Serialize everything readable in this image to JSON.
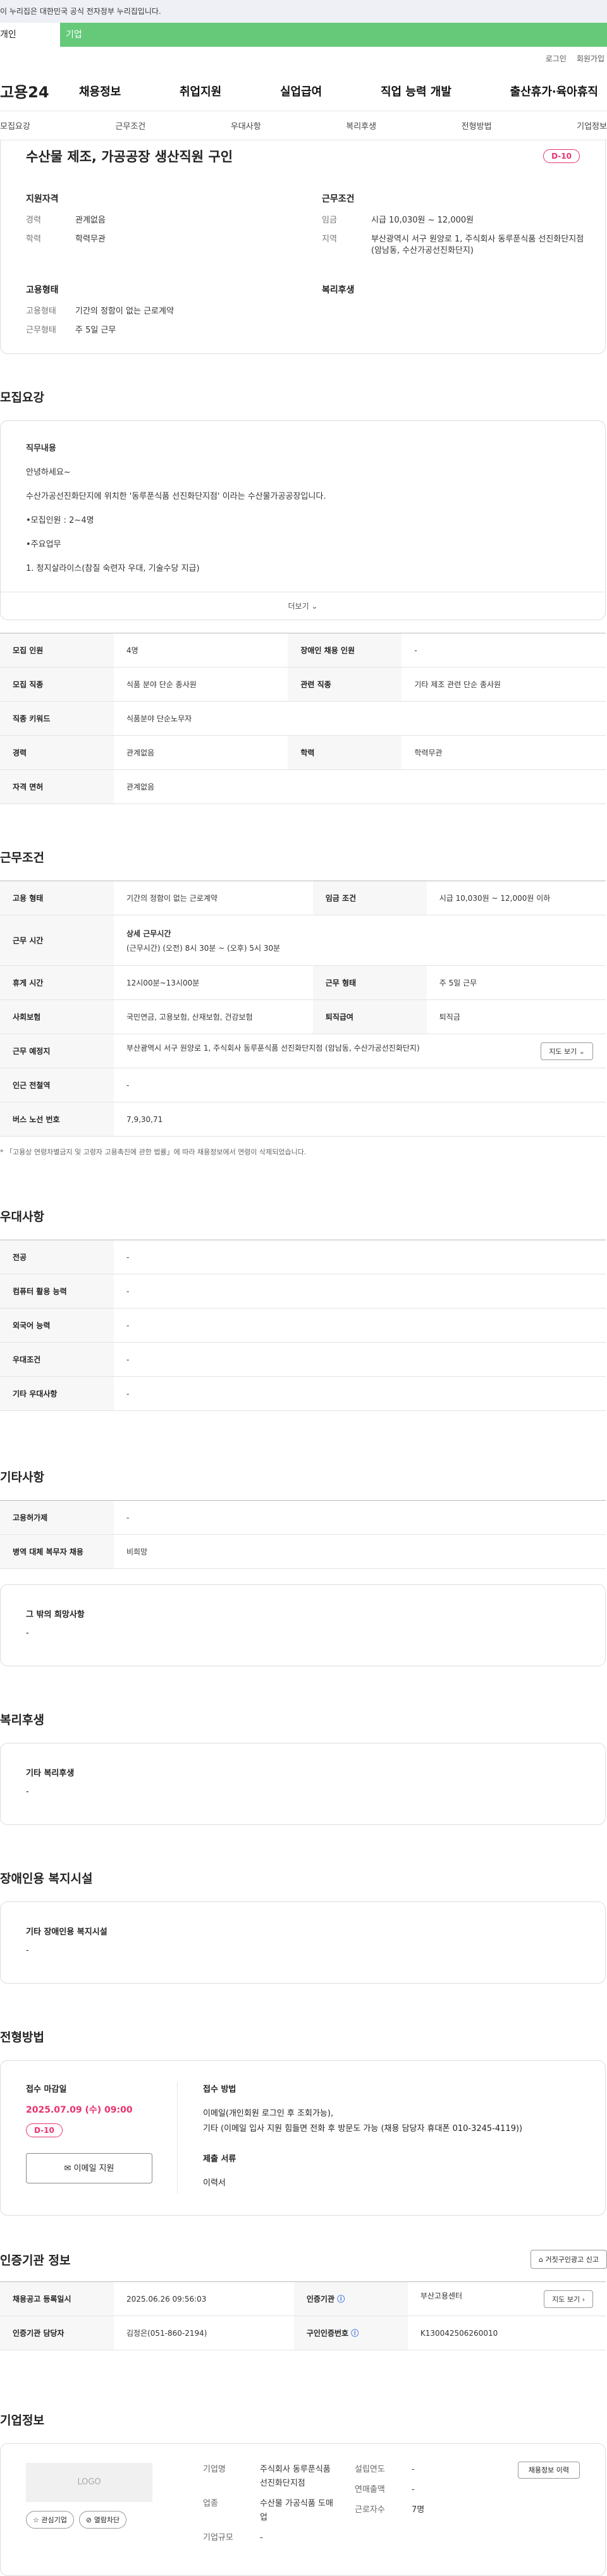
{
  "gov_banner": "이 누리집은 대한민국 공식 전자정부 누리집입니다.",
  "tabs": [
    {
      "label": "개인"
    },
    {
      "label": "기업"
    }
  ],
  "util": {
    "login": "로그인",
    "signup": "회원가입"
  },
  "gnb": {
    "logo": "고용24",
    "menu": [
      "채용정보",
      "취업지원",
      "실업급여",
      "직업 능력 개발",
      "출산휴가·육아휴직"
    ]
  },
  "subnav": [
    "모집요강",
    "근무조건",
    "우대사항",
    "복리후생",
    "전형방법",
    "기업정보"
  ],
  "summary": {
    "title": "수산물 제조, 가공공장 생산직원 구인",
    "dday": "D-10",
    "qual_title": "지원자격",
    "qual": [
      {
        "k": "경력",
        "v": "관계없음"
      },
      {
        "k": "학력",
        "v": "학력무관"
      }
    ],
    "cond_title": "근무조건",
    "cond": [
      {
        "k": "임금",
        "v": "시급 10,030원 ~ 12,000원"
      },
      {
        "k": "지역",
        "v": "부산광역시 서구 원양로 1, 주식회사 동루푼식품 선진화단지점 (암남동, 수산가공선진화단지)"
      }
    ],
    "emp_title": "고용형태",
    "emp": [
      {
        "k": "고용형태",
        "v": "기간의 정함이 없는 근로계약"
      },
      {
        "k": "근무형태",
        "v": "주 5일 근무"
      }
    ],
    "welfare_title": "복리후생"
  },
  "recruit": {
    "section_title": "모집요강",
    "desc_heading": "직무내용",
    "desc_lines": [
      "안녕하세요~",
      "수산가공선진화단지에 위치한 '동루푼식품 선진화단지점' 이라는 수산물가공공장입니다.",
      "•모집인원 : 2~4명",
      "•주요업무",
      "1. 청지살라이스(참질 숙련자 우대, 기술수당 지급)"
    ],
    "more_label": "더보기",
    "rows": [
      {
        "k1": "모집 인원",
        "v1": "4명",
        "k2": "장애인 채용 인원",
        "v2": "-"
      },
      {
        "k1": "모집 직종",
        "v1": "식품 분야 단순 종사원",
        "k2": "관련 직종",
        "v2": "기타 제조 관련 단순 종사원"
      },
      {
        "k1": "직종 키워드",
        "v1": "식품분야 단순노무자",
        "k2": "",
        "v2": ""
      },
      {
        "k1": "경력",
        "v1": "관계없음",
        "k2": "학력",
        "v2": "학력무관"
      },
      {
        "k1": "자격 면허",
        "v1": "관계없음",
        "k2": "",
        "v2": ""
      }
    ]
  },
  "work": {
    "section_title": "근무조건",
    "employment_type_label": "고용 형태",
    "employment_type": "기간의 정함이 없는 근로계약",
    "wage_label": "임금 조건",
    "wage": "시급 10,030원 ~ 12,000원 이하",
    "hours_label": "근무 시간",
    "hours_title": "상세 근무시간",
    "hours": "(근무시간) (오전) 8시 30분 ~ (오후) 5시 30분",
    "break_label": "휴게 시간",
    "break": "12시00분~13시00분",
    "form_label": "근무 형태",
    "form": "주 5일 근무",
    "insurance_label": "사회보험",
    "insurance": "국민연금, 고용보험, 산재보험, 건강보험",
    "retire_label": "퇴직급여",
    "retire": "퇴직금",
    "place_label": "근무 예정지",
    "place": "부산광역시 서구 원양로 1, 주식회사 동루푼식품 선진화단지점 (암남동, 수산가공선진화단지)",
    "map_btn": "지도 보기",
    "subway_label": "인근 전철역",
    "subway": "-",
    "bus_label": "버스 노선 번호",
    "bus": "7,9,30,71",
    "note": "* 「고용상 연령차별금지 및 고령자 고용촉진에 관한 법률」에 따라 채용정보에서 연령이 삭제되었습니다."
  },
  "pref": {
    "section_title": "우대사항",
    "rows": [
      {
        "k": "전공",
        "v": "-"
      },
      {
        "k": "컴퓨터 활용 능력",
        "v": "-"
      },
      {
        "k": "외국어 능력",
        "v": "-"
      },
      {
        "k": "우대조건",
        "v": "-"
      },
      {
        "k": "기타 우대사항",
        "v": "-"
      }
    ]
  },
  "etc": {
    "section_title": "기타사항",
    "rows": [
      {
        "k": "고용허가제",
        "v": "-"
      },
      {
        "k": "병역 대체 복무자 채용",
        "v": "비희망"
      }
    ],
    "other_title": "그 밖의 희망사항",
    "other_value": "-"
  },
  "welfare": {
    "section_title": "복리후생",
    "box_title": "기타 복리후생",
    "box_value": "-"
  },
  "disabled": {
    "section_title": "장애인용 복지시설",
    "box_title": "기타 장애인용 복지시설",
    "box_value": "-"
  },
  "selection": {
    "section_title": "전형방법",
    "deadline_title": "접수 마감일",
    "deadline": "2025.07.09 (수) 09:00",
    "dday": "D-10",
    "email_btn": "이메일 지원",
    "method_title": "접수 방법",
    "method_lines": [
      "이메일(개인회원 로그인 후 조회가능),",
      "기타 (이메일 입사 지원 힘들면 전화 후 방문도 가능 (채용 담당자 휴대폰 010-3245-4119))"
    ],
    "docs_title": "제출 서류",
    "docs": "이력서"
  },
  "cert": {
    "section_title": "인증기관 정보",
    "report_btn": "거짓구인광고 신고",
    "rows": [
      {
        "k1": "채용공고 등록일시",
        "v1": "2025.06.26 09:56:03",
        "k2": "인증기관",
        "v2": "부산고용센터"
      },
      {
        "k1": "인증기관 담당자",
        "v1": "김정은(051-860-2194)",
        "k2": "구인인증번호",
        "v2": "K130042506260010"
      }
    ],
    "map_btn": "지도 보기"
  },
  "company": {
    "section_title": "기업정보",
    "logo_text": "LOGO",
    "fav_btn": "관심기업",
    "block_btn": "열람차단",
    "name_label": "기업명",
    "name": "주식회사 동루푼식품 선진화단지점",
    "industry_label": "업종",
    "industry": "수산물 가공식품 도매업",
    "size_label": "기업규모",
    "size": "-",
    "founded_label": "설립연도",
    "founded": "-",
    "sales_label": "연매출액",
    "sales": "-",
    "employees_label": "근로자수",
    "employees": "7명",
    "recruit_btn": "채용정보 이력"
  }
}
